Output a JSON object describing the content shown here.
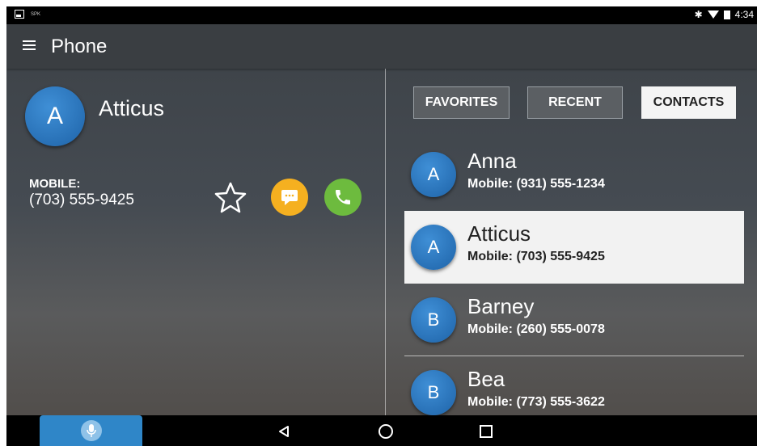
{
  "status_bar": {
    "left_label": "SPK",
    "time": "4:34"
  },
  "app_bar": {
    "title": "Phone"
  },
  "detail": {
    "avatar_letter": "A",
    "name": "Atticus",
    "mobile_label": "MOBILE:",
    "mobile_number": "(703) 555-9425"
  },
  "tabs": [
    {
      "label": "FAVORITES",
      "selected": false
    },
    {
      "label": "RECENT",
      "selected": false
    },
    {
      "label": "CONTACTS",
      "selected": true
    }
  ],
  "contacts": [
    {
      "letter": "A",
      "name": "Anna",
      "mobile": "Mobile:  (931) 555-1234",
      "selected": false
    },
    {
      "letter": "A",
      "name": "Atticus",
      "mobile": "Mobile:  (703) 555-9425",
      "selected": true
    },
    {
      "letter": "B",
      "name": "Barney",
      "mobile": "Mobile:  (260) 555-0078",
      "selected": false
    },
    {
      "letter": "B",
      "name": "Bea",
      "mobile": "Mobile:  (773) 555-3622",
      "selected": false
    }
  ],
  "icons": {
    "menu": "hamburger-menu-icon",
    "favorite": "star-outline-icon",
    "message": "message-icon",
    "call": "phone-icon",
    "mic": "microphone-icon",
    "back": "back-triangle-icon",
    "home": "home-circle-icon",
    "recents": "recents-square-icon"
  },
  "colors": {
    "avatar_blue": "#1e63a8",
    "message_orange": "#f5b020",
    "call_green": "#6dbb3e",
    "mic_blue": "#2f86c8"
  }
}
